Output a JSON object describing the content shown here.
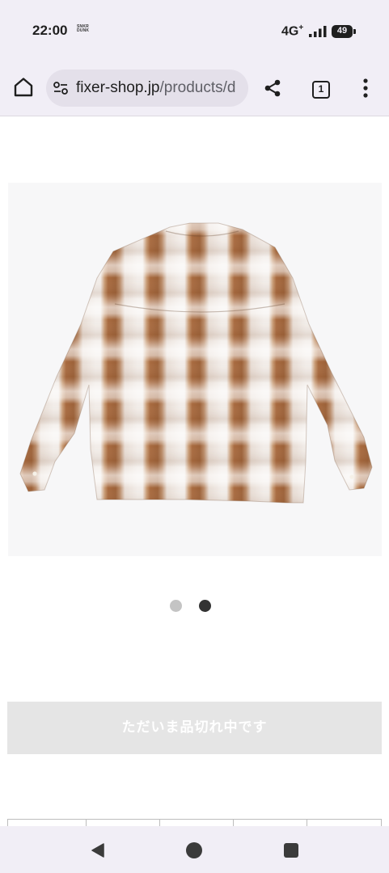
{
  "status_bar": {
    "time": "22:00",
    "mini_logo_lines": [
      "SNKR",
      "DUNK"
    ],
    "network": "4G",
    "network_plus": "+",
    "battery": "49"
  },
  "browser": {
    "url_host": "fixer-shop.jp",
    "url_path": "/products/d",
    "tab_count": "1"
  },
  "icons": {
    "home": "home-icon",
    "site_info": "tune-icon",
    "share": "share-icon",
    "menu": "more-vert-icon",
    "back": "back-triangle-icon",
    "nav_home": "home-circle-icon",
    "recents": "recents-square-icon"
  },
  "product": {
    "image_description": "Brown and white ombre plaid long sleeve shirt, back view",
    "slide_count": 2,
    "active_slide": 2,
    "button_label": "ただいま品切れ中です",
    "button_disabled": true
  },
  "colors": {
    "plaid_brown": "#a86a3f",
    "plaid_light": "#f2ede9",
    "sold_out_bg": "#e5e5e5",
    "system_bar_bg": "#f1eef6"
  }
}
